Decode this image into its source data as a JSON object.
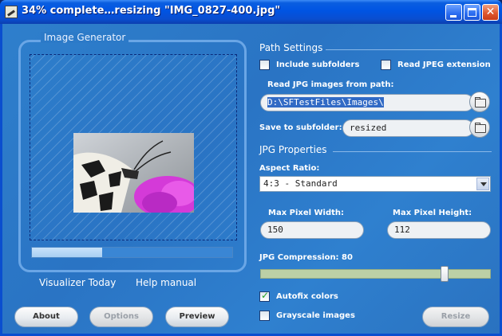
{
  "window": {
    "title": "34% complete…resizing \"IMG_0827-400.jpg\""
  },
  "colors": {
    "title_bar": "#0054e3",
    "window_body": "#2e7fcc",
    "close_button": "#e0582e",
    "progress_fill": "#b8d8f6",
    "selection": "#316ac5"
  },
  "image_generator": {
    "title": "Image Generator",
    "progress_fraction": 0.35,
    "preview_icon": "butterfly-photo",
    "links": {
      "visualizer": "Visualizer Today",
      "help": "Help manual"
    }
  },
  "buttons": {
    "about": "About",
    "options": "Options",
    "preview": "Preview",
    "resize": "Resize"
  },
  "path_settings": {
    "heading": "Path Settings",
    "include_subfolders": {
      "label": "Include subfolders",
      "checked": false
    },
    "read_jpeg_extension": {
      "label": "Read JPEG extension",
      "checked": false
    },
    "read_path_label": "Read JPG images from path:",
    "read_path_value": "D:\\SFTestFiles\\Images\\",
    "save_subfolder_label": "Save to subfolder:",
    "save_subfolder_value": "resized",
    "folder_icon": "folder-icon"
  },
  "jpg_properties": {
    "heading": "JPG Properties",
    "aspect_ratio_label": "Aspect Ratio:",
    "aspect_ratio_value": "4:3  - Standard",
    "max_width_label": "Max Pixel Width:",
    "max_width_value": "150",
    "max_height_label": "Max Pixel Height:",
    "max_height_value": "112",
    "compression_label": "JPG Compression: 80",
    "compression_value": 80,
    "autofix": {
      "label": "Autofix colors",
      "checked": true
    },
    "grayscale": {
      "label": "Grayscale images",
      "checked": false
    }
  }
}
